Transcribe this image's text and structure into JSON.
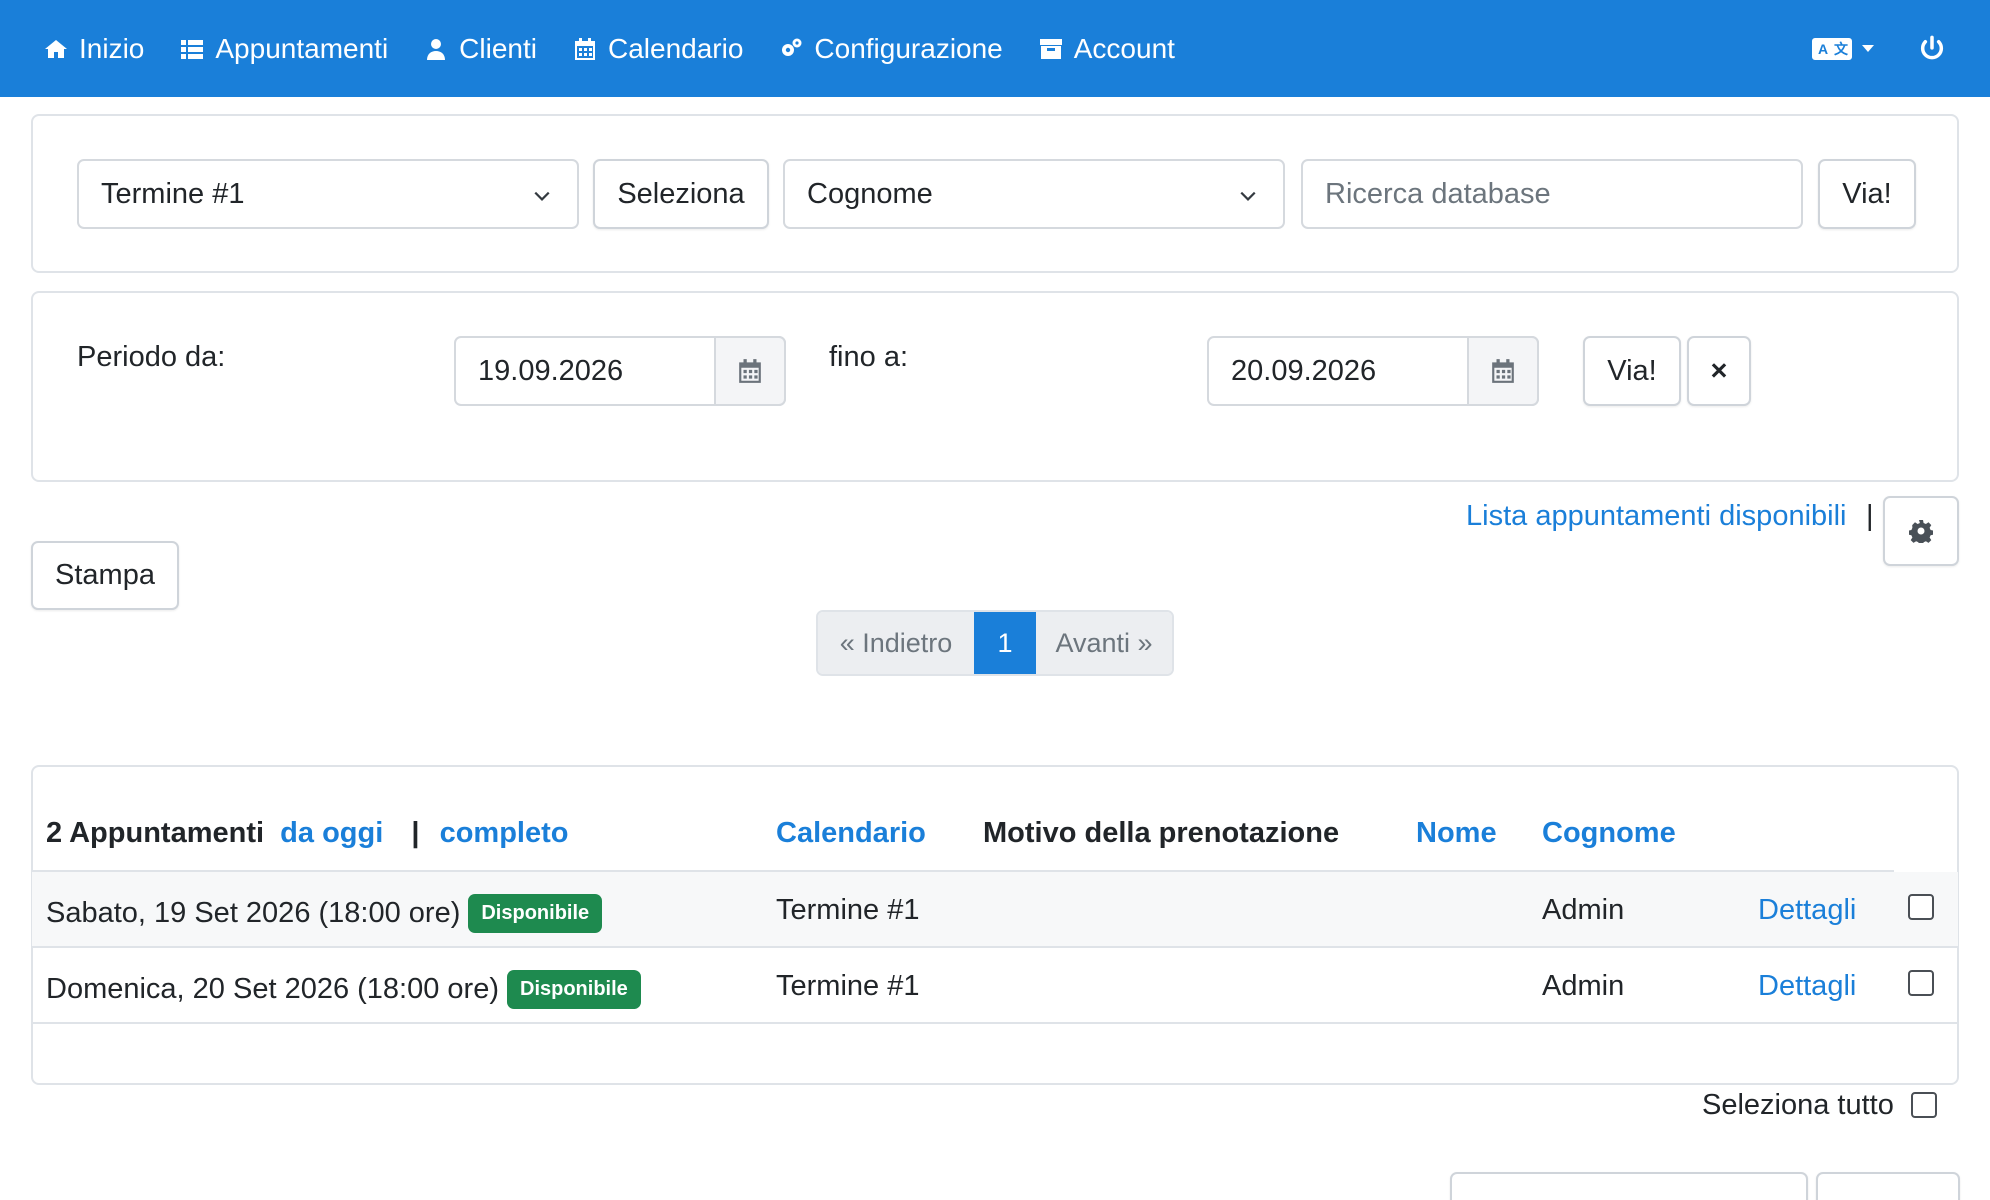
{
  "nav": {
    "items": [
      {
        "label": "Inizio",
        "icon": "home-icon"
      },
      {
        "label": "Appuntamenti",
        "icon": "list-icon"
      },
      {
        "label": "Clienti",
        "icon": "user-icon"
      },
      {
        "label": "Calendario",
        "icon": "calendar-icon"
      },
      {
        "label": "Configurazione",
        "icon": "gears-icon"
      },
      {
        "label": "Account",
        "icon": "archive-icon"
      }
    ],
    "language_icon": "translate-icon",
    "power_icon": "power-icon"
  },
  "search": {
    "calendar_select": "Termine #1",
    "select_button": "Seleziona",
    "field_select": "Cognome",
    "search_placeholder": "Ricerca database",
    "go_button": "Via!"
  },
  "period": {
    "from_label": "Periodo da:",
    "from_value": "19.09.2026",
    "to_label": "fino a:",
    "to_value": "20.09.2026",
    "go_button": "Via!",
    "clear_button": "×"
  },
  "actions": {
    "available_list_link": "Lista appuntamenti disponibili",
    "separator": "|",
    "print_button": "Stampa"
  },
  "pagination": {
    "prev": "« Indietro",
    "current": "1",
    "next": "Avanti »"
  },
  "table": {
    "count_title": "2 Appuntamenti",
    "from_today_link": "da oggi",
    "separator": "|",
    "complete_link": "completo",
    "headers": {
      "calendar": "Calendario",
      "reason": "Motivo della prenotazione",
      "first_name": "Nome",
      "last_name": "Cognome"
    },
    "rows": [
      {
        "date": "Sabato, 19 Set 2026 (18:00 ore)",
        "status": "Disponibile",
        "calendar": "Termine #1",
        "last_name": "Admin",
        "details": "Dettagli"
      },
      {
        "date": "Domenica, 20 Set 2026 (18:00 ore)",
        "status": "Disponibile",
        "calendar": "Termine #1",
        "last_name": "Admin",
        "details": "Dettagli"
      }
    ],
    "select_all_label": "Seleziona tutto"
  },
  "colors": {
    "primary": "#1a7fd9",
    "success": "#1e8a4f"
  }
}
